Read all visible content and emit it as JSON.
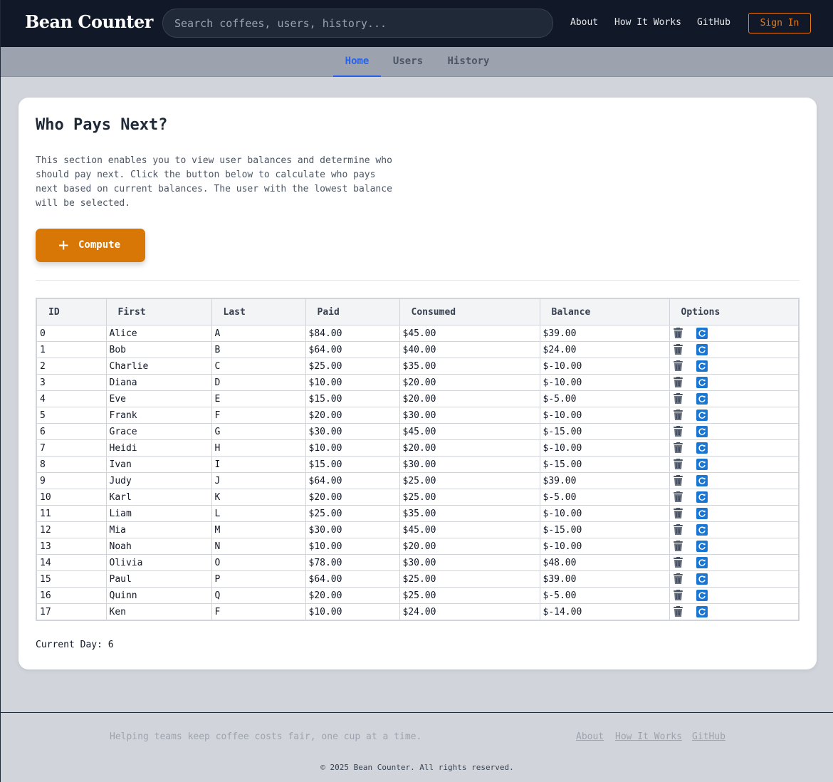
{
  "app": {
    "brand": "Bean Counter"
  },
  "header": {
    "search_placeholder": "Search coffees, users, history...",
    "nav": [
      "About",
      "How It Works",
      "GitHub"
    ],
    "sign_in": "Sign In"
  },
  "tabs": {
    "items": [
      "Home",
      "Users",
      "History"
    ],
    "active": "Home"
  },
  "main": {
    "title": "Who Pays Next?",
    "description": "This section enables you to view user balances and determine who should pay next. Click the button below to calculate who pays next based on current balances. The user with the lowest balance will be selected.",
    "compute_label": "Compute",
    "current_day_label": "Current Day: 6"
  },
  "table": {
    "headers": [
      "ID",
      "First",
      "Last",
      "Paid",
      "Consumed",
      "Balance",
      "Options"
    ],
    "rows": [
      [
        "0",
        "Alice",
        "A",
        "$84.00",
        "$45.00",
        "$39.00"
      ],
      [
        "1",
        "Bob",
        "B",
        "$64.00",
        "$40.00",
        "$24.00"
      ],
      [
        "2",
        "Charlie",
        "C",
        "$25.00",
        "$35.00",
        "$-10.00"
      ],
      [
        "3",
        "Diana",
        "D",
        "$10.00",
        "$20.00",
        "$-10.00"
      ],
      [
        "4",
        "Eve",
        "E",
        "$15.00",
        "$20.00",
        "$-5.00"
      ],
      [
        "5",
        "Frank",
        "F",
        "$20.00",
        "$30.00",
        "$-10.00"
      ],
      [
        "6",
        "Grace",
        "G",
        "$30.00",
        "$45.00",
        "$-15.00"
      ],
      [
        "7",
        "Heidi",
        "H",
        "$10.00",
        "$20.00",
        "$-10.00"
      ],
      [
        "8",
        "Ivan",
        "I",
        "$15.00",
        "$30.00",
        "$-15.00"
      ],
      [
        "9",
        "Judy",
        "J",
        "$64.00",
        "$25.00",
        "$39.00"
      ],
      [
        "10",
        "Karl",
        "K",
        "$20.00",
        "$25.00",
        "$-5.00"
      ],
      [
        "11",
        "Liam",
        "L",
        "$25.00",
        "$35.00",
        "$-10.00"
      ],
      [
        "12",
        "Mia",
        "M",
        "$30.00",
        "$45.00",
        "$-15.00"
      ],
      [
        "13",
        "Noah",
        "N",
        "$10.00",
        "$20.00",
        "$-10.00"
      ],
      [
        "14",
        "Olivia",
        "O",
        "$78.00",
        "$30.00",
        "$48.00"
      ],
      [
        "15",
        "Paul",
        "P",
        "$64.00",
        "$25.00",
        "$39.00"
      ],
      [
        "16",
        "Quinn",
        "Q",
        "$20.00",
        "$25.00",
        "$-5.00"
      ],
      [
        "17",
        "Ken",
        "F",
        "$10.00",
        "$24.00",
        "$-14.00"
      ]
    ],
    "option_icons": [
      "trash-icon",
      "refresh-icon"
    ]
  },
  "footer": {
    "tagline": "Helping teams keep coffee costs fair, one cup at a time.",
    "links": [
      "About",
      "How It Works",
      "GitHub"
    ],
    "copyright": "© 2025 Bean Counter. All rights reserved."
  },
  "colors": {
    "accent": "#d97706",
    "active_tab": "#2563eb",
    "header_bg": "#111827"
  }
}
